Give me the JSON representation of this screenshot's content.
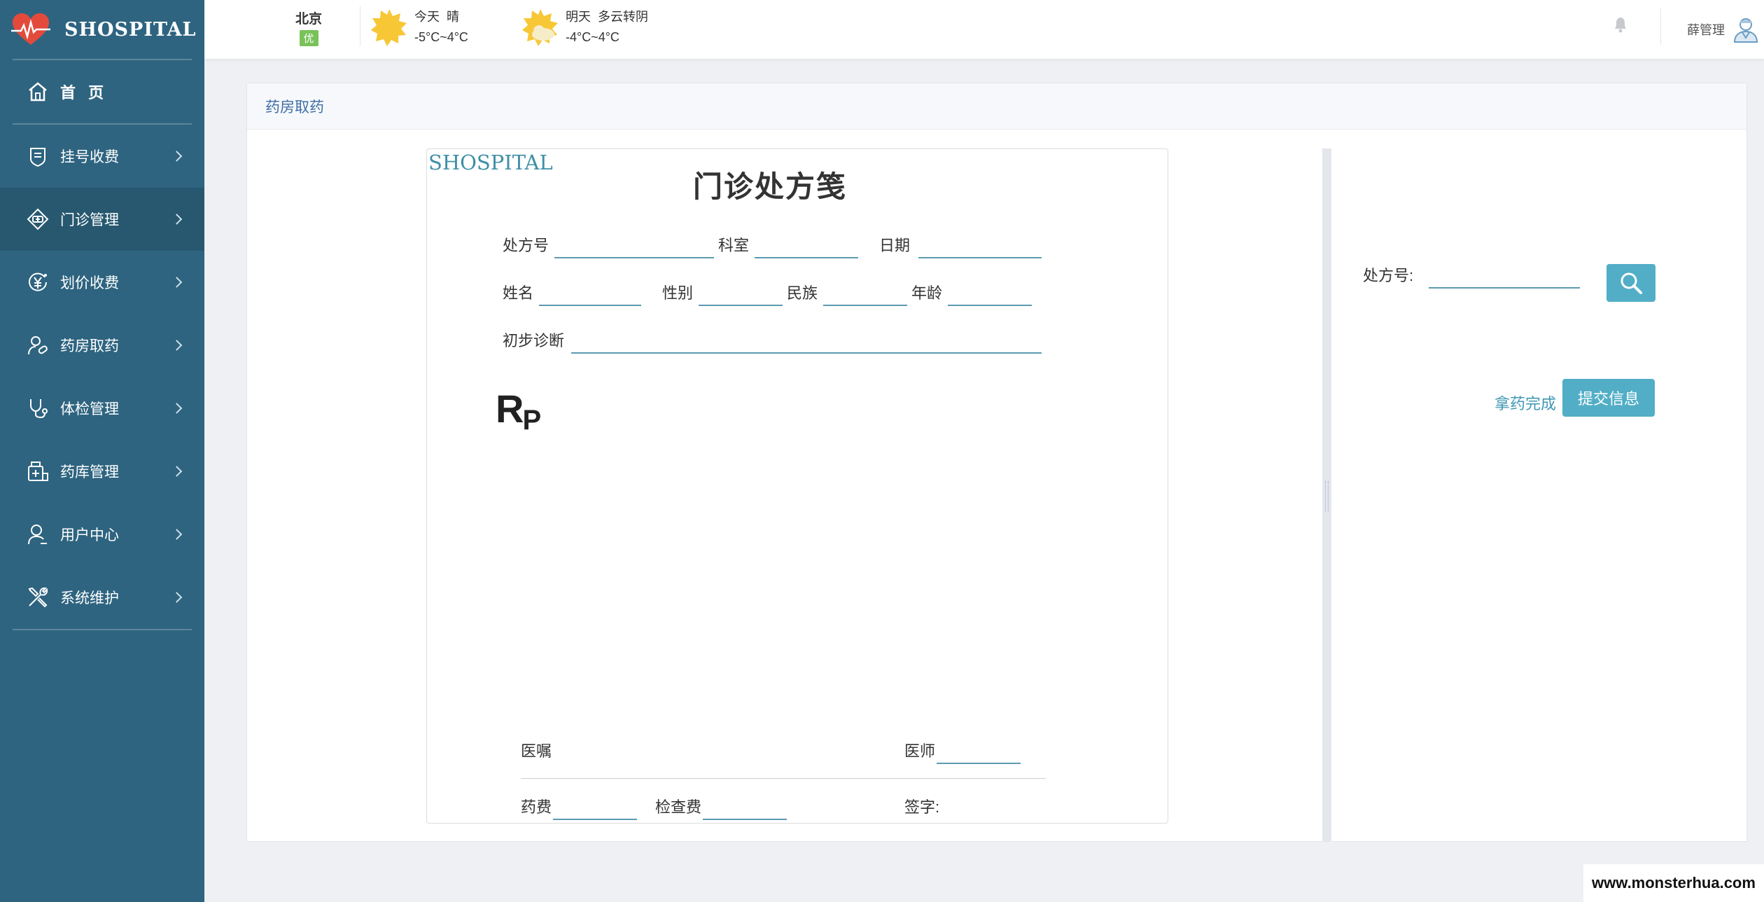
{
  "app": {
    "name": "SHOSPITAL"
  },
  "sidebar": {
    "home": {
      "label": "首 页",
      "icon": "home-icon"
    },
    "items": [
      {
        "label": "挂号收费",
        "icon": "registration-icon"
      },
      {
        "label": "门诊管理",
        "icon": "clinic-icon",
        "active": true
      },
      {
        "label": "划价收费",
        "icon": "yen-coin-icon"
      },
      {
        "label": "药房取药",
        "icon": "pharmacy-icon"
      },
      {
        "label": "体检管理",
        "icon": "stethoscope-icon"
      },
      {
        "label": "药库管理",
        "icon": "medicine-store-icon"
      },
      {
        "label": "用户中心",
        "icon": "user-icon"
      },
      {
        "label": "系统维护",
        "icon": "tools-icon"
      }
    ]
  },
  "topbar": {
    "city": "北京",
    "aqi": "优",
    "today": {
      "label": "今天",
      "condition": "晴",
      "temp": "-5°C~4°C"
    },
    "tomorrow": {
      "label": "明天",
      "condition": "多云转阴",
      "temp": "-4°C~4°C"
    },
    "user": "薛管理"
  },
  "page": {
    "breadcrumb": "药房取药"
  },
  "prescription": {
    "logo": "SHOSPITAL",
    "title": "门诊处方笺",
    "fields": {
      "rx_no": "处方号",
      "dept": "科室",
      "date": "日期",
      "name": "姓名",
      "gender": "性别",
      "ethnicity": "民族",
      "age": "年龄",
      "diagnosis": "初步诊断",
      "advice": "医嘱",
      "doctor": "医师",
      "drug_fee": "药费",
      "exam_fee": "检查费",
      "signature": "签字:"
    },
    "rp_main": "R",
    "rp_sub": "P"
  },
  "search_panel": {
    "label": "处方号:",
    "value": "",
    "done_link": "拿药完成",
    "submit": "提交信息"
  },
  "watermark": "www.monsterhua.com",
  "colors": {
    "sidebar": "#2e6480",
    "accent": "#52aec6",
    "link": "#3f98b3"
  }
}
